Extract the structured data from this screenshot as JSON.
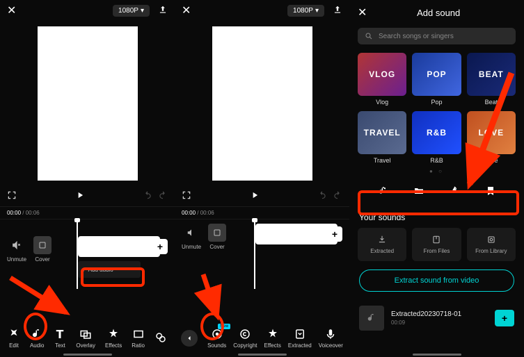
{
  "panel1": {
    "resolution": "1080P",
    "time_current": "00:00",
    "time_total": "00:06",
    "unmute_label": "Unmute",
    "cover_label": "Cover",
    "add_audio_label": "Add audio",
    "toolbar": [
      {
        "name": "edit",
        "label": "Edit"
      },
      {
        "name": "audio",
        "label": "Audio"
      },
      {
        "name": "text",
        "label": "Text"
      },
      {
        "name": "overlay",
        "label": "Overlay"
      },
      {
        "name": "effects",
        "label": "Effects"
      },
      {
        "name": "ratio",
        "label": "Ratio"
      },
      {
        "name": "filter",
        "label": ""
      }
    ]
  },
  "panel2": {
    "resolution": "1080P",
    "time_current": "00:00",
    "time_total": "00:06",
    "unmute_label": "Unmute",
    "cover_label": "Cover",
    "toolbar": [
      {
        "name": "sounds",
        "label": "Sounds",
        "badge": "New"
      },
      {
        "name": "copyright",
        "label": "Copyright"
      },
      {
        "name": "effects",
        "label": "Effects"
      },
      {
        "name": "extracted",
        "label": "Extracted"
      },
      {
        "name": "voiceover",
        "label": "Voiceover"
      }
    ]
  },
  "panel3": {
    "title": "Add sound",
    "search_placeholder": "Search songs or singers",
    "categories_row1": [
      {
        "text": "VLOG",
        "label": "Vlog",
        "bg": "bg-vlog"
      },
      {
        "text": "POP",
        "label": "Pop",
        "bg": "bg-pop"
      },
      {
        "text": "BEAT",
        "label": "Beat",
        "bg": "bg-beat"
      }
    ],
    "categories_row2": [
      {
        "text": "TRAVEL",
        "label": "Travel",
        "bg": "bg-travel"
      },
      {
        "text": "R&B",
        "label": "R&B",
        "bg": "bg-rnb"
      },
      {
        "text": "LOVE",
        "label": "Love",
        "bg": "bg-love"
      }
    ],
    "section_title": "Your sounds",
    "sources": [
      {
        "name": "extracted",
        "label": "Extracted"
      },
      {
        "name": "files",
        "label": "From Files"
      },
      {
        "name": "library",
        "label": "From Library"
      }
    ],
    "extract_button": "Extract sound from video",
    "sound_item": {
      "name": "Extracted20230718-01",
      "duration": "00:09"
    },
    "add_label": "+"
  },
  "colors": {
    "accent": "#ff2a00",
    "teal": "#00d4d4"
  }
}
